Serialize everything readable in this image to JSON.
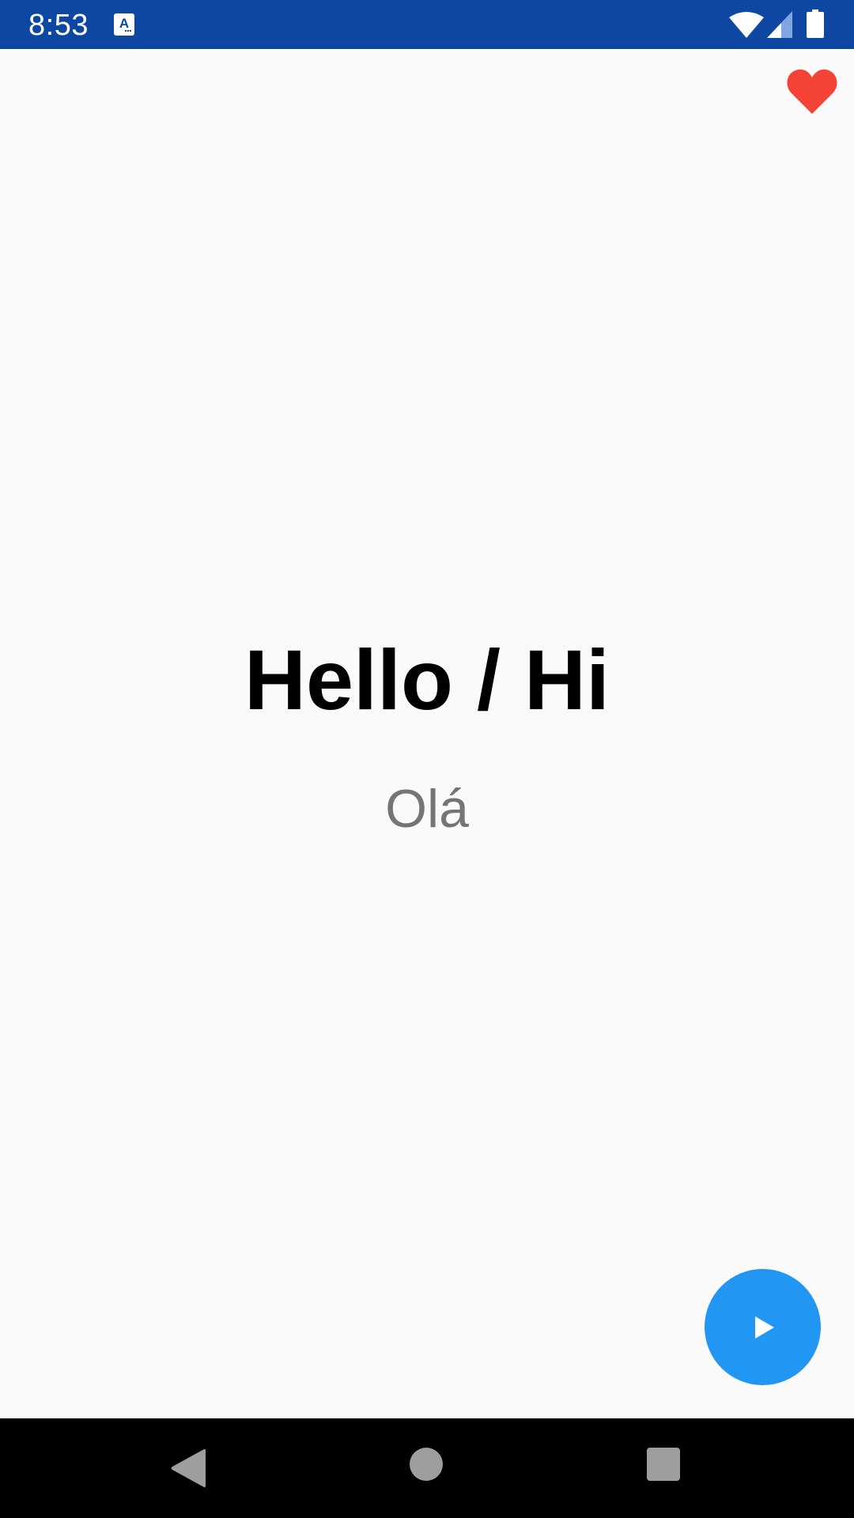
{
  "status_bar": {
    "time": "8:53",
    "icons": [
      "a-icon",
      "wifi-icon",
      "signal-icon",
      "battery-icon"
    ],
    "background_color": "#0d47a1"
  },
  "favorite": {
    "icon": "heart-icon",
    "state": "filled",
    "color": "#f44336"
  },
  "card": {
    "phrase": "Hello / Hi",
    "translation": "Olá"
  },
  "fab": {
    "icon": "play-icon",
    "color": "#2196f3"
  },
  "nav_bar": {
    "buttons": [
      "back-icon",
      "home-icon",
      "recents-icon"
    ]
  }
}
